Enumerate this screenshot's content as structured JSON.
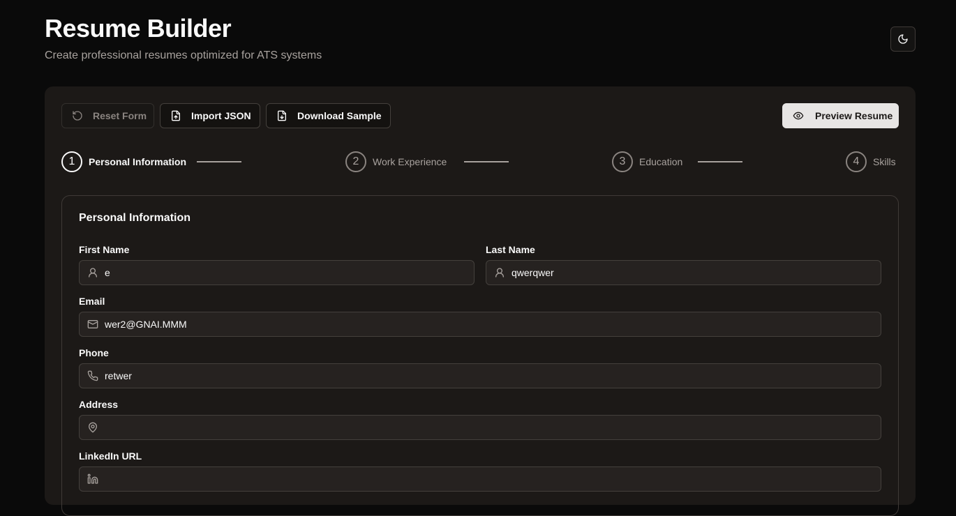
{
  "header": {
    "title": "Resume Builder",
    "subtitle": "Create professional resumes optimized for ATS systems",
    "theme_icon": "moon-icon"
  },
  "toolbar": {
    "reset_label": "Reset Form",
    "import_label": "Import JSON",
    "download_label": "Download Sample",
    "preview_label": "Preview Resume"
  },
  "steps": [
    {
      "number": "1",
      "label": "Personal Information",
      "active": true
    },
    {
      "number": "2",
      "label": "Work Experience",
      "active": false
    },
    {
      "number": "3",
      "label": "Education",
      "active": false
    },
    {
      "number": "4",
      "label": "Skills",
      "active": false
    }
  ],
  "form": {
    "title": "Personal Information",
    "fields": {
      "first_name": {
        "label": "First Name",
        "value": "e",
        "icon": "user-icon"
      },
      "last_name": {
        "label": "Last Name",
        "value": "qwerqwer",
        "icon": "user-icon"
      },
      "email": {
        "label": "Email",
        "value": "wer2@GNAI.MMM",
        "icon": "mail-icon"
      },
      "phone": {
        "label": "Phone",
        "value": "retwer",
        "icon": "phone-icon"
      },
      "address": {
        "label": "Address",
        "value": "",
        "icon": "map-pin-icon"
      },
      "linkedin": {
        "label": "LinkedIn URL",
        "value": "",
        "icon": "linkedin-icon"
      }
    }
  },
  "colors": {
    "background": "#0a0a0a",
    "panel": "#1c1917",
    "accent": "#e7e5e4",
    "text": "#fafafa",
    "muted": "#a8a29e"
  }
}
